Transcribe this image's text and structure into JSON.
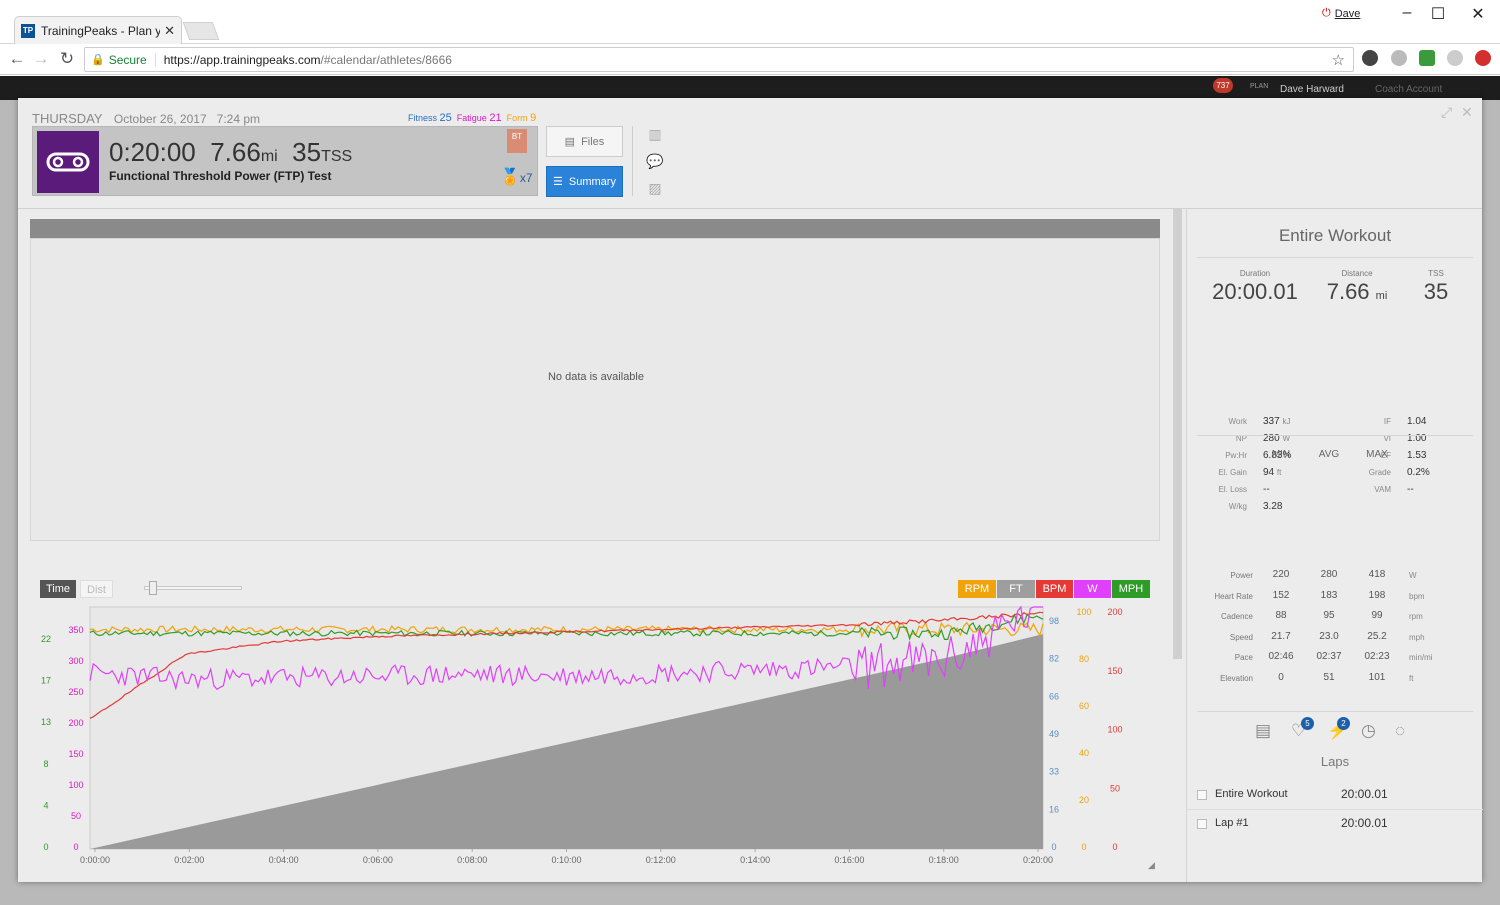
{
  "browser": {
    "tab_title": "TrainingPeaks - Plan your",
    "tab_favicon": "TP",
    "profile_name": "Dave",
    "secure_label": "Secure",
    "url_domain": "https://app.trainingpeaks.com",
    "url_path": "/#calendar/athletes/8666"
  },
  "appbar": {
    "notifications": "737",
    "plan_label": "PLAN",
    "user": "Dave Harward",
    "coach": "Coach Account"
  },
  "workout": {
    "day": "THURSDAY",
    "date": "October 26, 2017",
    "time": "7:24 pm",
    "fitness_label": "Fitness",
    "fitness_value": "25",
    "fatigue_label": "Fatigue",
    "fatigue_value": "21",
    "form_label": "Form",
    "form_value": "9",
    "duration": "0:20:00",
    "distance": "7.66",
    "distance_unit": "mi",
    "tss": "35",
    "tss_unit": "TSS",
    "title": "Functional Threshold Power (FTP) Test",
    "bt_badge": "BT",
    "medal_count": "x7",
    "files_label": "Files",
    "summary_label": "Summary"
  },
  "map": {
    "no_data": "No data is available"
  },
  "graph": {
    "time_label": "Time",
    "dist_label": "Dist",
    "channels": [
      {
        "label": "RPM",
        "color": "#f0a30a"
      },
      {
        "label": "FT",
        "color": "#9e9e9e"
      },
      {
        "label": "BPM",
        "color": "#e53935"
      },
      {
        "label": "W",
        "color": "#e040fb"
      },
      {
        "label": "MPH",
        "color": "#2e9d28"
      }
    ]
  },
  "chart_data": {
    "type": "line",
    "x_ticks": [
      "0:00:00",
      "0:02:00",
      "0:04:00",
      "0:06:00",
      "0:08:00",
      "0:10:00",
      "0:12:00",
      "0:14:00",
      "0:16:00",
      "0:18:00",
      "0:20:00"
    ],
    "axes": {
      "speed_mph": [
        "22",
        "17",
        "13",
        "8",
        "4",
        "0"
      ],
      "power_w": [
        "350",
        "300",
        "250",
        "200",
        "150",
        "100",
        "50",
        "0"
      ],
      "elevation_ft": [
        "98",
        "82",
        "66",
        "49",
        "33",
        "16",
        "0"
      ],
      "cadence_rpm": [
        "100",
        "80",
        "60",
        "40",
        "20",
        "0"
      ],
      "heart_rate_bpm": [
        "200",
        "150",
        "100",
        "50",
        "0"
      ]
    },
    "series": [
      {
        "name": "RPM",
        "color": "#f0a30a",
        "approx": "flat ~95, 88-99"
      },
      {
        "name": "BPM",
        "color": "#e53935",
        "values_hint": [
          152,
          165,
          172,
          176,
          178,
          180,
          182,
          184,
          186,
          190,
          198
        ]
      },
      {
        "name": "W",
        "color": "#e040fb",
        "values_hint": [
          280,
          270,
          272,
          275,
          278,
          275,
          280,
          285,
          290,
          300,
          418
        ]
      },
      {
        "name": "MPH",
        "color": "#2e9d28",
        "values_hint": [
          23,
          23,
          23,
          23,
          23,
          23,
          23,
          23,
          23,
          23,
          25
        ]
      },
      {
        "name": "FT",
        "color": "#9e9e9e",
        "values_hint": [
          0,
          10,
          20,
          30,
          40,
          50,
          60,
          70,
          80,
          90,
          101
        ]
      }
    ]
  },
  "summary": {
    "title": "Entire Workout",
    "duration_label": "Duration",
    "duration": "20:00.01",
    "distance_label": "Distance",
    "distance": "7.66",
    "distance_unit": "mi",
    "tss_label": "TSS",
    "tss": "35",
    "left_stats": [
      {
        "k": "Work",
        "v": "337",
        "u": "kJ"
      },
      {
        "k": "NP",
        "v": "280",
        "u": "W"
      },
      {
        "k": "Pw:Hr",
        "v": "6.83%",
        "u": ""
      },
      {
        "k": "El. Gain",
        "v": "94",
        "u": "ft"
      },
      {
        "k": "El. Loss",
        "v": "--",
        "u": ""
      },
      {
        "k": "W/kg",
        "v": "3.28",
        "u": ""
      }
    ],
    "right_stats": [
      {
        "k": "IF",
        "v": "1.04"
      },
      {
        "k": "VI",
        "v": "1.00"
      },
      {
        "k": "EF",
        "v": "1.53"
      },
      {
        "k": "Grade",
        "v": "0.2%"
      },
      {
        "k": "VAM",
        "v": "--"
      }
    ],
    "mm_headers": [
      "MIN",
      "AVG",
      "MAX"
    ],
    "mm_rows": [
      {
        "label": "Power",
        "min": "220",
        "avg": "280",
        "max": "418",
        "unit": "W"
      },
      {
        "label": "Heart Rate",
        "min": "152",
        "avg": "183",
        "max": "198",
        "unit": "bpm"
      },
      {
        "label": "Cadence",
        "min": "88",
        "avg": "95",
        "max": "99",
        "unit": "rpm"
      },
      {
        "label": "Speed",
        "min": "21.7",
        "avg": "23.0",
        "max": "25.2",
        "unit": "mph"
      },
      {
        "label": "Pace",
        "min": "02:46",
        "avg": "02:37",
        "max": "02:23",
        "unit": "min/mi"
      },
      {
        "label": "Elevation",
        "min": "0",
        "avg": "51",
        "max": "101",
        "unit": "ft"
      }
    ],
    "badge_peaks": "5",
    "badge_power": "2",
    "laps_title": "Laps",
    "laps": [
      {
        "name": "Entire Workout",
        "duration": "20:00.01"
      },
      {
        "name": "Lap #1",
        "duration": "20:00.01"
      }
    ]
  }
}
